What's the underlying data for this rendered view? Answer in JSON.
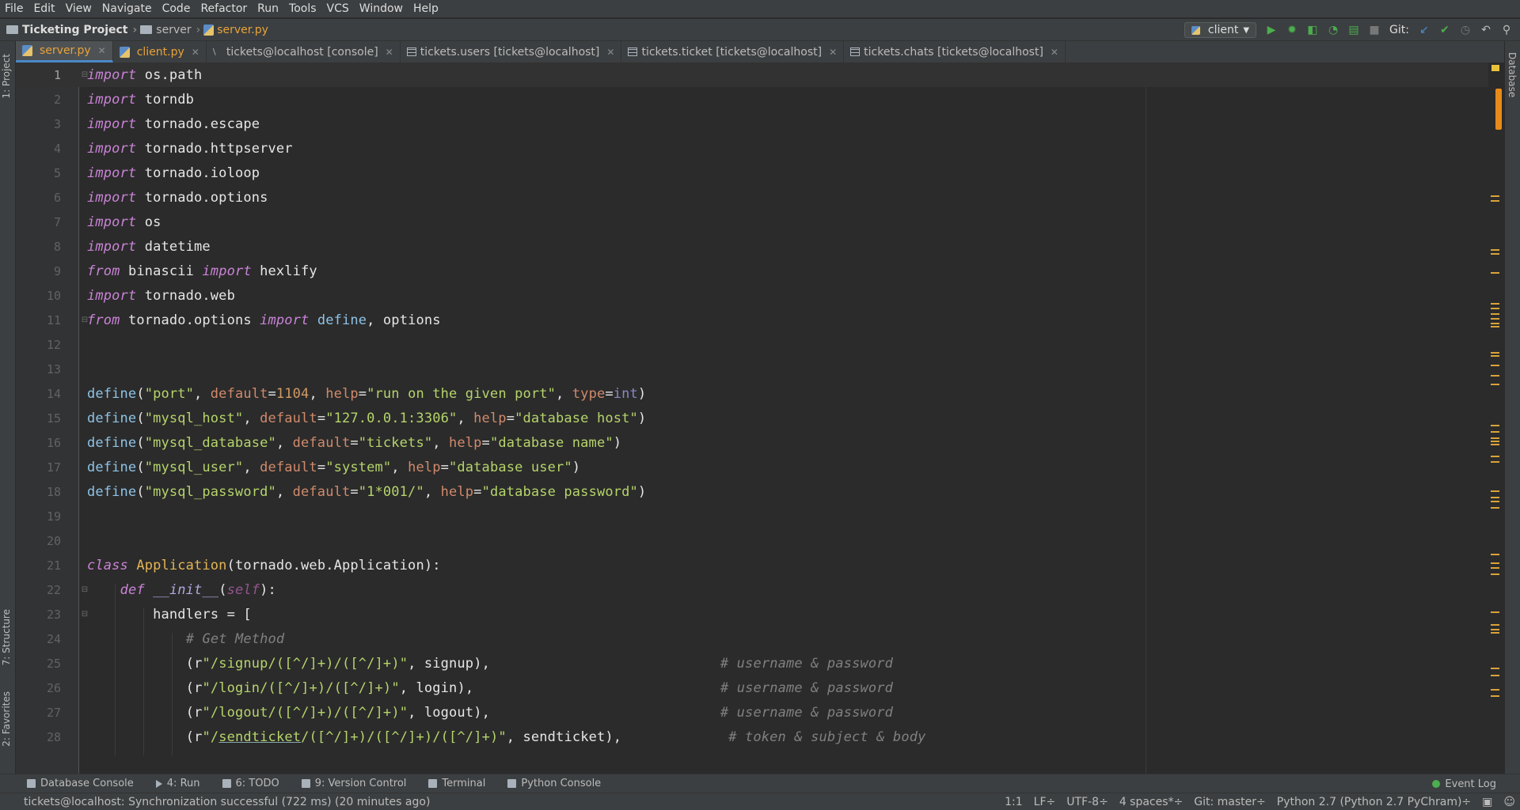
{
  "menu": [
    "File",
    "Edit",
    "View",
    "Navigate",
    "Code",
    "Refactor",
    "Run",
    "Tools",
    "VCS",
    "Window",
    "Help"
  ],
  "breadcrumb": {
    "project": "Ticketing Project",
    "folder": "server",
    "file": "server.py"
  },
  "run_config": "client",
  "git_label": "Git:",
  "tabs": [
    {
      "label": "server.py"
    },
    {
      "label": "client.py"
    },
    {
      "label": "tickets@localhost [console]"
    },
    {
      "label": "tickets.users [tickets@localhost]"
    },
    {
      "label": "tickets.ticket [tickets@localhost]"
    },
    {
      "label": "tickets.chats [tickets@localhost]"
    }
  ],
  "left_tools": {
    "project": "1: Project",
    "structure": "7: Structure",
    "favorites": "2: Favorites"
  },
  "right_tools": {
    "database": "Database"
  },
  "editor": {
    "language": "python",
    "current_line": 1,
    "lines": [
      "import os.path",
      "import torndb",
      "import tornado.escape",
      "import tornado.httpserver",
      "import tornado.ioloop",
      "import tornado.options",
      "import os",
      "import datetime",
      "from binascii import hexlify",
      "import tornado.web",
      "from tornado.options import define, options",
      "",
      "",
      "define(\"port\", default=1104, help=\"run on the given port\", type=int)",
      "define(\"mysql_host\", default=\"127.0.0.1:3306\", help=\"database host\")",
      "define(\"mysql_database\", default=\"tickets\", help=\"database name\")",
      "define(\"mysql_user\", default=\"system\", help=\"database user\")",
      "define(\"mysql_password\", default=\"1*001/\", help=\"database password\")",
      "",
      "",
      "class Application(tornado.web.Application):",
      "    def __init__(self):",
      "        handlers = [",
      "            # Get Method",
      "            (r\"/signup/([^/]+)/([^/]+)\", signup),                            # username & password",
      "            (r\"/login/([^/]+)/([^/]+)\", login),                              # username & password",
      "            (r\"/logout/([^/]+)/([^/]+)\", logout),                            # username & password",
      "            (r\"/sendticket/([^/]+)/([^/]+)/([^/]+)\", sendticket),             # token & subject & body"
    ]
  },
  "bottom_tools": [
    "Database Console",
    "4: Run",
    "6: TODO",
    "9: Version Control",
    "Terminal",
    "Python Console"
  ],
  "event_log": "Event Log",
  "status": {
    "message": "tickets@localhost: Synchronization successful (722 ms) (20 minutes ago)",
    "position": "1:1",
    "line_sep": "LF÷",
    "encoding": "UTF-8÷",
    "indent": "4 spaces*÷",
    "branch": "Git: master÷",
    "interpreter": "Python 2.7 (Python 2.7 PyChram)÷"
  }
}
